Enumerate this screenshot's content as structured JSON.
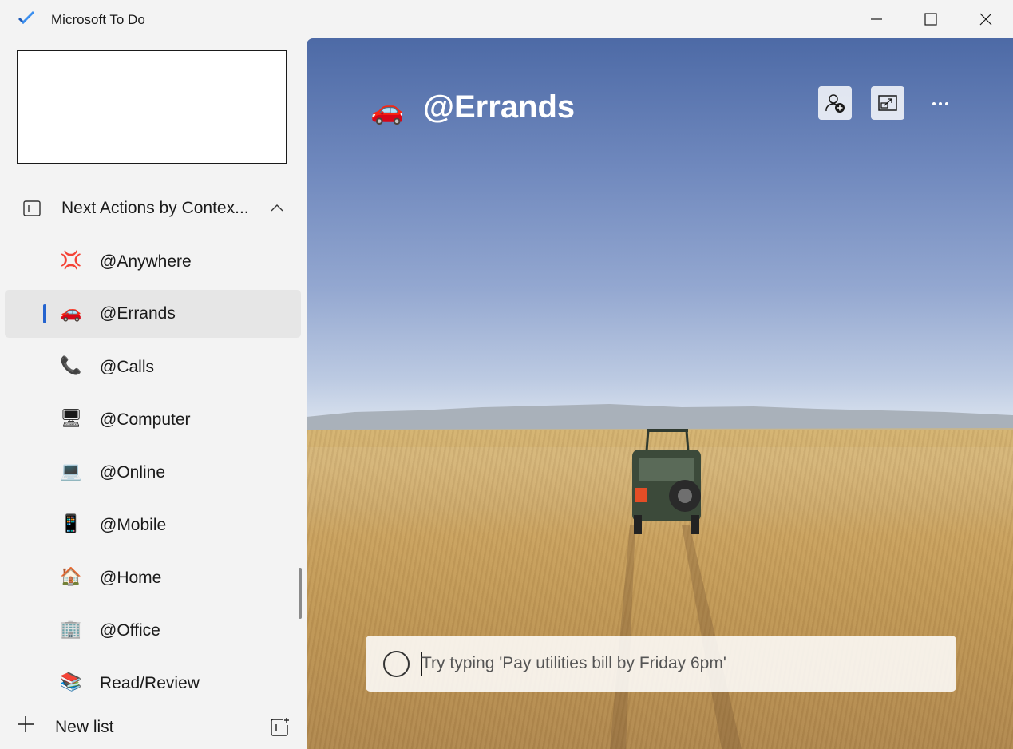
{
  "window": {
    "title": "Microsoft To Do",
    "logo_icon": "todo-check-icon",
    "controls": [
      "minimize-icon",
      "maximize-icon",
      "close-icon"
    ]
  },
  "sidebar": {
    "group": {
      "label": "Next Actions by Contex...",
      "icon": "group-icon",
      "expanded": true
    },
    "items": [
      {
        "emoji": "💢",
        "label": "@Anywhere",
        "selected": false
      },
      {
        "emoji": "🚗",
        "label": "@Errands",
        "selected": true
      },
      {
        "emoji": "📞",
        "label": "@Calls",
        "selected": false
      },
      {
        "emoji": "🖥",
        "label": "@Computer",
        "selected": false
      },
      {
        "emoji": "💻",
        "label": "@Online",
        "selected": false
      },
      {
        "emoji": "📱",
        "label": "@Mobile",
        "selected": false
      },
      {
        "emoji": "🏠",
        "label": "@Home",
        "selected": false
      },
      {
        "emoji": "🏢",
        "label": "@Office",
        "selected": false
      },
      {
        "emoji": "📚",
        "label": "Read/Review",
        "selected": false
      }
    ],
    "new_list_label": "New list"
  },
  "main": {
    "list_emoji": "🚗",
    "list_title": "@Errands",
    "toolbar": [
      "share-person-icon",
      "change-background-icon",
      "more-options-icon"
    ],
    "add_task_placeholder": "Try typing 'Pay utilities bill by Friday 6pm'",
    "add_task_value": ""
  },
  "colors": {
    "accent": "#2564cf",
    "sidebar_bg": "#f3f3f3",
    "selected_item_bg": "#e6e6e6"
  }
}
